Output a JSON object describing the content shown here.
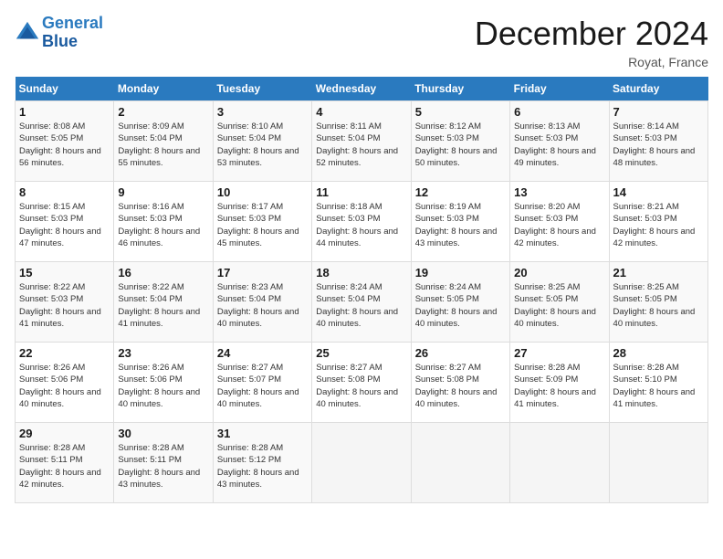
{
  "header": {
    "logo_line1": "General",
    "logo_line2": "Blue",
    "month_title": "December 2024",
    "location": "Royat, France"
  },
  "weekdays": [
    "Sunday",
    "Monday",
    "Tuesday",
    "Wednesday",
    "Thursday",
    "Friday",
    "Saturday"
  ],
  "weeks": [
    [
      {
        "day": "1",
        "sunrise": "Sunrise: 8:08 AM",
        "sunset": "Sunset: 5:05 PM",
        "daylight": "Daylight: 8 hours and 56 minutes."
      },
      {
        "day": "2",
        "sunrise": "Sunrise: 8:09 AM",
        "sunset": "Sunset: 5:04 PM",
        "daylight": "Daylight: 8 hours and 55 minutes."
      },
      {
        "day": "3",
        "sunrise": "Sunrise: 8:10 AM",
        "sunset": "Sunset: 5:04 PM",
        "daylight": "Daylight: 8 hours and 53 minutes."
      },
      {
        "day": "4",
        "sunrise": "Sunrise: 8:11 AM",
        "sunset": "Sunset: 5:04 PM",
        "daylight": "Daylight: 8 hours and 52 minutes."
      },
      {
        "day": "5",
        "sunrise": "Sunrise: 8:12 AM",
        "sunset": "Sunset: 5:03 PM",
        "daylight": "Daylight: 8 hours and 50 minutes."
      },
      {
        "day": "6",
        "sunrise": "Sunrise: 8:13 AM",
        "sunset": "Sunset: 5:03 PM",
        "daylight": "Daylight: 8 hours and 49 minutes."
      },
      {
        "day": "7",
        "sunrise": "Sunrise: 8:14 AM",
        "sunset": "Sunset: 5:03 PM",
        "daylight": "Daylight: 8 hours and 48 minutes."
      }
    ],
    [
      {
        "day": "8",
        "sunrise": "Sunrise: 8:15 AM",
        "sunset": "Sunset: 5:03 PM",
        "daylight": "Daylight: 8 hours and 47 minutes."
      },
      {
        "day": "9",
        "sunrise": "Sunrise: 8:16 AM",
        "sunset": "Sunset: 5:03 PM",
        "daylight": "Daylight: 8 hours and 46 minutes."
      },
      {
        "day": "10",
        "sunrise": "Sunrise: 8:17 AM",
        "sunset": "Sunset: 5:03 PM",
        "daylight": "Daylight: 8 hours and 45 minutes."
      },
      {
        "day": "11",
        "sunrise": "Sunrise: 8:18 AM",
        "sunset": "Sunset: 5:03 PM",
        "daylight": "Daylight: 8 hours and 44 minutes."
      },
      {
        "day": "12",
        "sunrise": "Sunrise: 8:19 AM",
        "sunset": "Sunset: 5:03 PM",
        "daylight": "Daylight: 8 hours and 43 minutes."
      },
      {
        "day": "13",
        "sunrise": "Sunrise: 8:20 AM",
        "sunset": "Sunset: 5:03 PM",
        "daylight": "Daylight: 8 hours and 42 minutes."
      },
      {
        "day": "14",
        "sunrise": "Sunrise: 8:21 AM",
        "sunset": "Sunset: 5:03 PM",
        "daylight": "Daylight: 8 hours and 42 minutes."
      }
    ],
    [
      {
        "day": "15",
        "sunrise": "Sunrise: 8:22 AM",
        "sunset": "Sunset: 5:03 PM",
        "daylight": "Daylight: 8 hours and 41 minutes."
      },
      {
        "day": "16",
        "sunrise": "Sunrise: 8:22 AM",
        "sunset": "Sunset: 5:04 PM",
        "daylight": "Daylight: 8 hours and 41 minutes."
      },
      {
        "day": "17",
        "sunrise": "Sunrise: 8:23 AM",
        "sunset": "Sunset: 5:04 PM",
        "daylight": "Daylight: 8 hours and 40 minutes."
      },
      {
        "day": "18",
        "sunrise": "Sunrise: 8:24 AM",
        "sunset": "Sunset: 5:04 PM",
        "daylight": "Daylight: 8 hours and 40 minutes."
      },
      {
        "day": "19",
        "sunrise": "Sunrise: 8:24 AM",
        "sunset": "Sunset: 5:05 PM",
        "daylight": "Daylight: 8 hours and 40 minutes."
      },
      {
        "day": "20",
        "sunrise": "Sunrise: 8:25 AM",
        "sunset": "Sunset: 5:05 PM",
        "daylight": "Daylight: 8 hours and 40 minutes."
      },
      {
        "day": "21",
        "sunrise": "Sunrise: 8:25 AM",
        "sunset": "Sunset: 5:05 PM",
        "daylight": "Daylight: 8 hours and 40 minutes."
      }
    ],
    [
      {
        "day": "22",
        "sunrise": "Sunrise: 8:26 AM",
        "sunset": "Sunset: 5:06 PM",
        "daylight": "Daylight: 8 hours and 40 minutes."
      },
      {
        "day": "23",
        "sunrise": "Sunrise: 8:26 AM",
        "sunset": "Sunset: 5:06 PM",
        "daylight": "Daylight: 8 hours and 40 minutes."
      },
      {
        "day": "24",
        "sunrise": "Sunrise: 8:27 AM",
        "sunset": "Sunset: 5:07 PM",
        "daylight": "Daylight: 8 hours and 40 minutes."
      },
      {
        "day": "25",
        "sunrise": "Sunrise: 8:27 AM",
        "sunset": "Sunset: 5:08 PM",
        "daylight": "Daylight: 8 hours and 40 minutes."
      },
      {
        "day": "26",
        "sunrise": "Sunrise: 8:27 AM",
        "sunset": "Sunset: 5:08 PM",
        "daylight": "Daylight: 8 hours and 40 minutes."
      },
      {
        "day": "27",
        "sunrise": "Sunrise: 8:28 AM",
        "sunset": "Sunset: 5:09 PM",
        "daylight": "Daylight: 8 hours and 41 minutes."
      },
      {
        "day": "28",
        "sunrise": "Sunrise: 8:28 AM",
        "sunset": "Sunset: 5:10 PM",
        "daylight": "Daylight: 8 hours and 41 minutes."
      }
    ],
    [
      {
        "day": "29",
        "sunrise": "Sunrise: 8:28 AM",
        "sunset": "Sunset: 5:11 PM",
        "daylight": "Daylight: 8 hours and 42 minutes."
      },
      {
        "day": "30",
        "sunrise": "Sunrise: 8:28 AM",
        "sunset": "Sunset: 5:11 PM",
        "daylight": "Daylight: 8 hours and 43 minutes."
      },
      {
        "day": "31",
        "sunrise": "Sunrise: 8:28 AM",
        "sunset": "Sunset: 5:12 PM",
        "daylight": "Daylight: 8 hours and 43 minutes."
      },
      null,
      null,
      null,
      null
    ]
  ]
}
